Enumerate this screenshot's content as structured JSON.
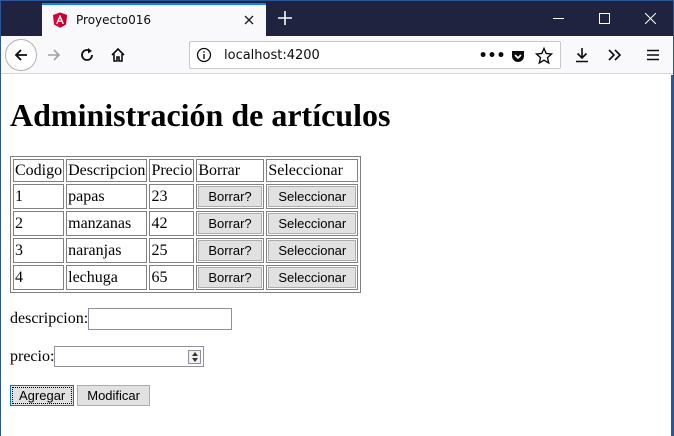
{
  "browser": {
    "tab_title": "Proyecto016",
    "url": "localhost:4200",
    "page_actions_glyph": "•••"
  },
  "page": {
    "heading": "Administración de artículos",
    "table": {
      "headers": [
        "Codigo",
        "Descripcion",
        "Precio",
        "Borrar",
        "Seleccionar"
      ],
      "rows": [
        {
          "codigo": "1",
          "descripcion": "papas",
          "precio": "23"
        },
        {
          "codigo": "2",
          "descripcion": "manzanas",
          "precio": "42"
        },
        {
          "codigo": "3",
          "descripcion": "naranjas",
          "precio": "25"
        },
        {
          "codigo": "4",
          "descripcion": "lechuga",
          "precio": "65"
        }
      ],
      "delete_label": "Borrar?",
      "select_label": "Seleccionar"
    },
    "form": {
      "descripcion_label": "descripcion:",
      "descripcion_value": "",
      "precio_label": "precio:",
      "precio_value": "",
      "add_label": "Agregar",
      "modify_label": "Modificar"
    }
  },
  "colors": {
    "tabbar": "#202340",
    "accent": "#0a84ff",
    "window_border": "#2b5797"
  }
}
